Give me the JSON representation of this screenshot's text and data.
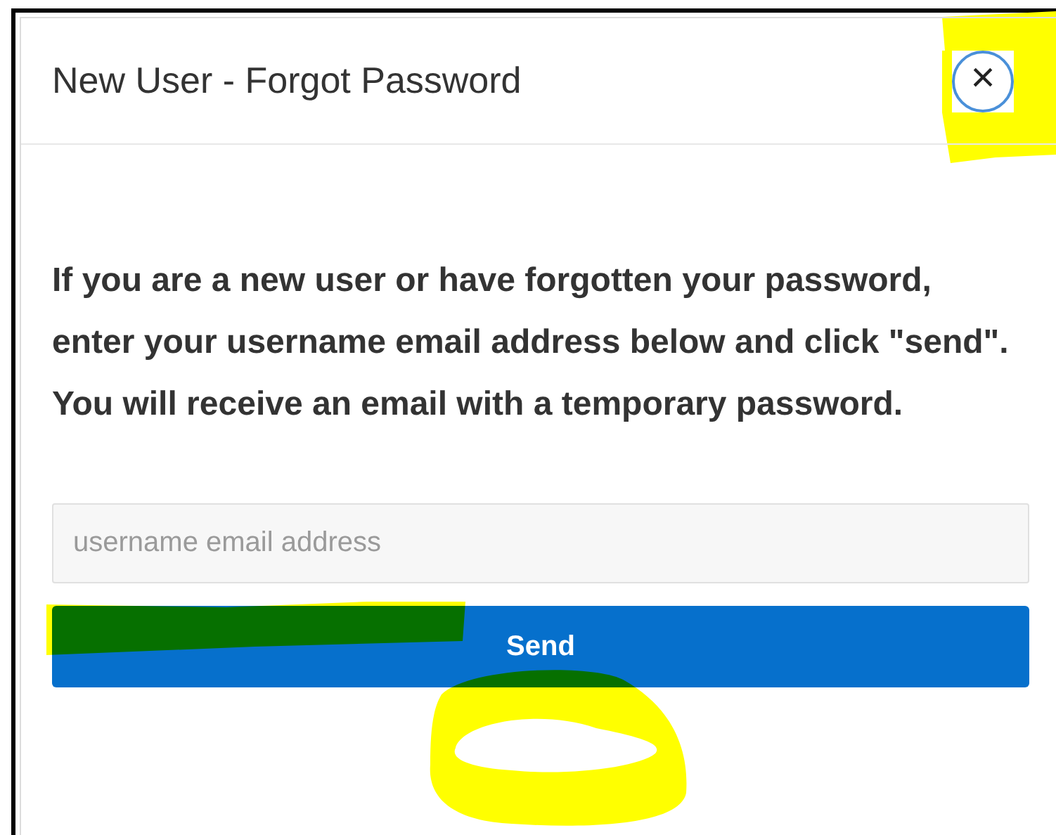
{
  "dialog": {
    "title": "New User - Forgot Password",
    "close_label": "×"
  },
  "instructions": "If you are a new user or have forgotten your password, enter your username email address below and click \"send\". You will receive an email with a temporary password.",
  "email_field": {
    "placeholder": "username email address"
  },
  "send_button": "Send"
}
